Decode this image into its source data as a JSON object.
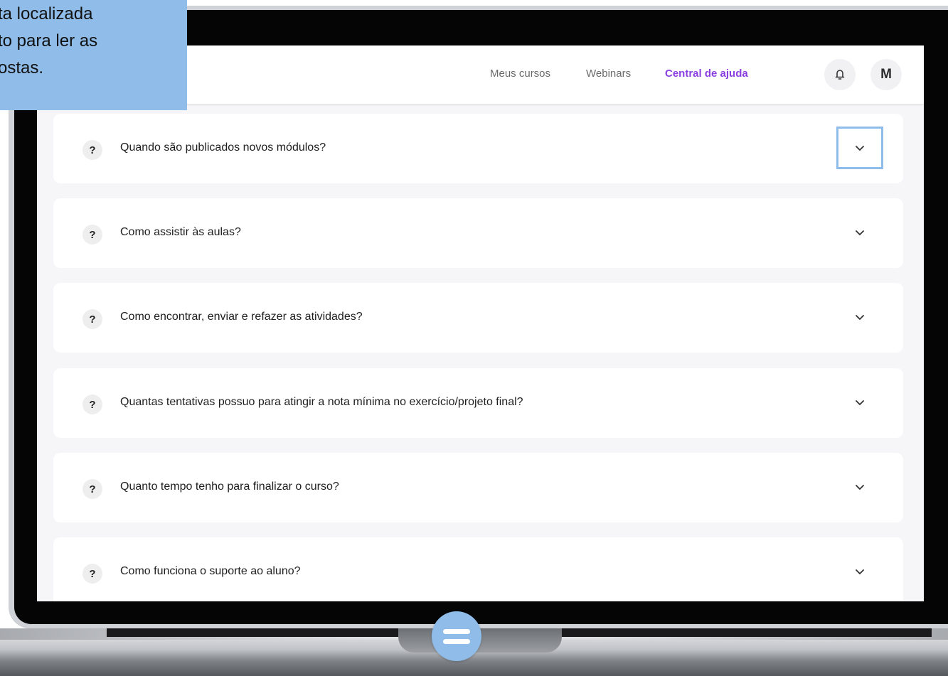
{
  "nav": {
    "links": [
      {
        "label": "Meus cursos"
      },
      {
        "label": "Webinars"
      },
      {
        "label": "Central de ajuda"
      }
    ],
    "avatar_initial": "M",
    "notification_icon": "bell-icon"
  },
  "faq": {
    "items": [
      {
        "question": "Quando são publicados novos módulos?"
      },
      {
        "question": "Como assistir às aulas?"
      },
      {
        "question": "Como encontrar, enviar e refazer as atividades?"
      },
      {
        "question": "Quantas tentativas possuo para atingir a nota mínima no exercício/projeto final?"
      },
      {
        "question": "Quanto tempo tenho para finalizar o curso?"
      },
      {
        "question": "Como funciona o suporte ao aluno?"
      }
    ],
    "badge_symbol": "?"
  },
  "tooltip": {
    "lines": [
      "ta localizada",
      "to para ler as",
      "ostas."
    ]
  },
  "colors": {
    "accent": "#8a3fe0",
    "highlight": "#8fbce8"
  }
}
